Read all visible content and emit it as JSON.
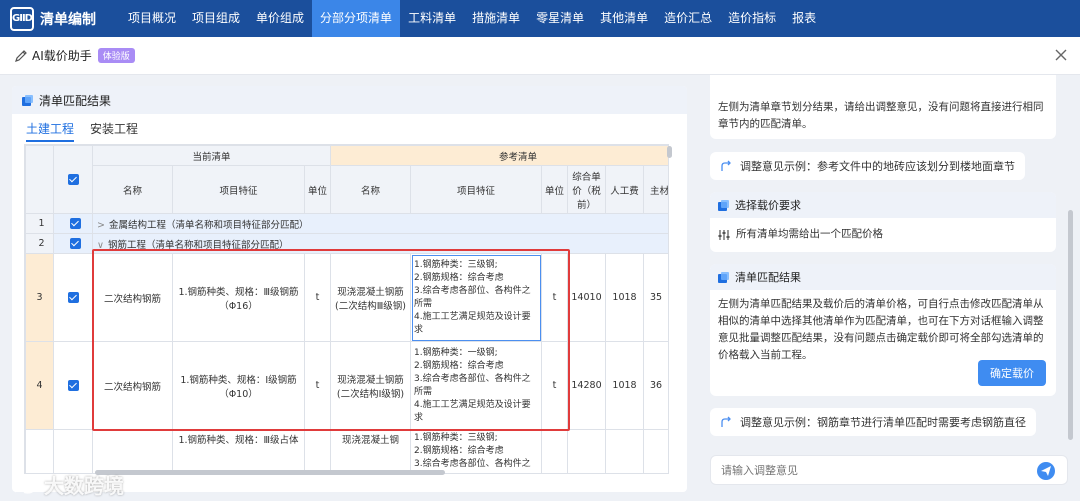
{
  "app": {
    "logo_mark": "GIID",
    "title": "清单编制"
  },
  "nav": [
    {
      "label": "项目概况",
      "active": false
    },
    {
      "label": "项目组成",
      "active": false
    },
    {
      "label": "单价组成",
      "active": false
    },
    {
      "label": "分部分项清单",
      "active": true
    },
    {
      "label": "工料清单",
      "active": false
    },
    {
      "label": "措施清单",
      "active": false
    },
    {
      "label": "零星清单",
      "active": false
    },
    {
      "label": "其他清单",
      "active": false
    },
    {
      "label": "造价汇总",
      "active": false
    },
    {
      "label": "造价指标",
      "active": false
    },
    {
      "label": "报表",
      "active": false
    }
  ],
  "ai_bar": {
    "title": "AI载价助手",
    "badge": "体验版"
  },
  "left": {
    "title": "清单匹配结果",
    "tabs": [
      {
        "label": "土建工程",
        "active": true
      },
      {
        "label": "安装工程",
        "active": false
      }
    ]
  },
  "table": {
    "group_current": "当前清单",
    "group_ref": "参考清单",
    "headers": {
      "name": "名称",
      "feature": "项目特征",
      "unit": "单位",
      "ref_name": "名称",
      "ref_feature": "项目特征",
      "ref_unit": "单位",
      "price": "综合单价（税前）",
      "labor": "人工费",
      "material": "主材"
    },
    "groups": [
      {
        "num": "1",
        "chevron": ">",
        "label": "金属结构工程（清单名称和项目特征部分匹配）"
      },
      {
        "num": "2",
        "chevron": "∨",
        "label": "钢筋工程（清单名称和项目特征部分匹配）"
      }
    ],
    "rows": [
      {
        "num": "3",
        "name": "二次结构钢筋",
        "feature": "1.钢筋种类、规格：Ⅲ级钢筋（Φ16）",
        "unit": "t",
        "ref_name": "现浇混凝土钢筋(二次结构Ⅲ级钢)",
        "ref_feature": [
          "1.钢筋种类：三级钢;",
          "2.钢筋规格：综合考虑",
          "3.综合考虑各部位、各构件之所需",
          "4.施工工艺满足规范及设计要求"
        ],
        "ref_unit": "t",
        "price": "14010",
        "labor": "1018",
        "material": "35"
      },
      {
        "num": "4",
        "name": "二次结构钢筋",
        "feature": "1.钢筋种类、规格：Ⅰ级钢筋（Φ10）",
        "unit": "t",
        "ref_name": "现浇混凝土钢筋(二次结构Ⅰ级钢)",
        "ref_feature": [
          "1.钢筋种类：一级钢;",
          "2.钢筋规格：综合考虑",
          "3.综合考虑各部位、各构件之所需",
          "4.施工工艺满足规范及设计要求"
        ],
        "ref_unit": "t",
        "price": "14280",
        "labor": "1018",
        "material": "36"
      }
    ],
    "partial_row": {
      "feature": "1.钢筋种类、规格：Ⅲ级占体",
      "ref_name": "现浇混凝土钢",
      "ref_feature": [
        "1.钢筋种类：三级钢;",
        "2.钢筋规格：综合考虑",
        "3.综合考虑各部位、各构件之"
      ]
    }
  },
  "chat": {
    "msg1": "左侧为清单章节划分结果，请给出调整意见，没有问题将直接进行相同章节内的匹配清单。",
    "tip1": "调整意见示例：参考文件中的地砖应该划分到楼地面章节",
    "card2_title": "选择载价要求",
    "card2_body": "所有清单均需给出一个匹配价格",
    "card3_title": "清单匹配结果",
    "card3_body": "左侧为清单匹配结果及载价后的清单价格，可自行点击修改匹配清单从相似的清单中选择其他清单作为匹配清单，也可在下方对话框输入调整意见批量调整匹配结果，没有问题点击确定载价即可将全部勾选清单的价格载入当前工程。",
    "confirm_label": "确定载价",
    "tip2": "调整意见示例：钢筋章节进行清单匹配时需要考虑钢筋直径",
    "input_placeholder": "请输入调整意见"
  },
  "watermark": "大数跨境"
}
